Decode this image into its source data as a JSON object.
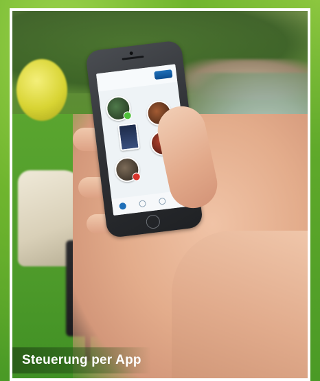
{
  "caption": "Steuerung per App"
}
